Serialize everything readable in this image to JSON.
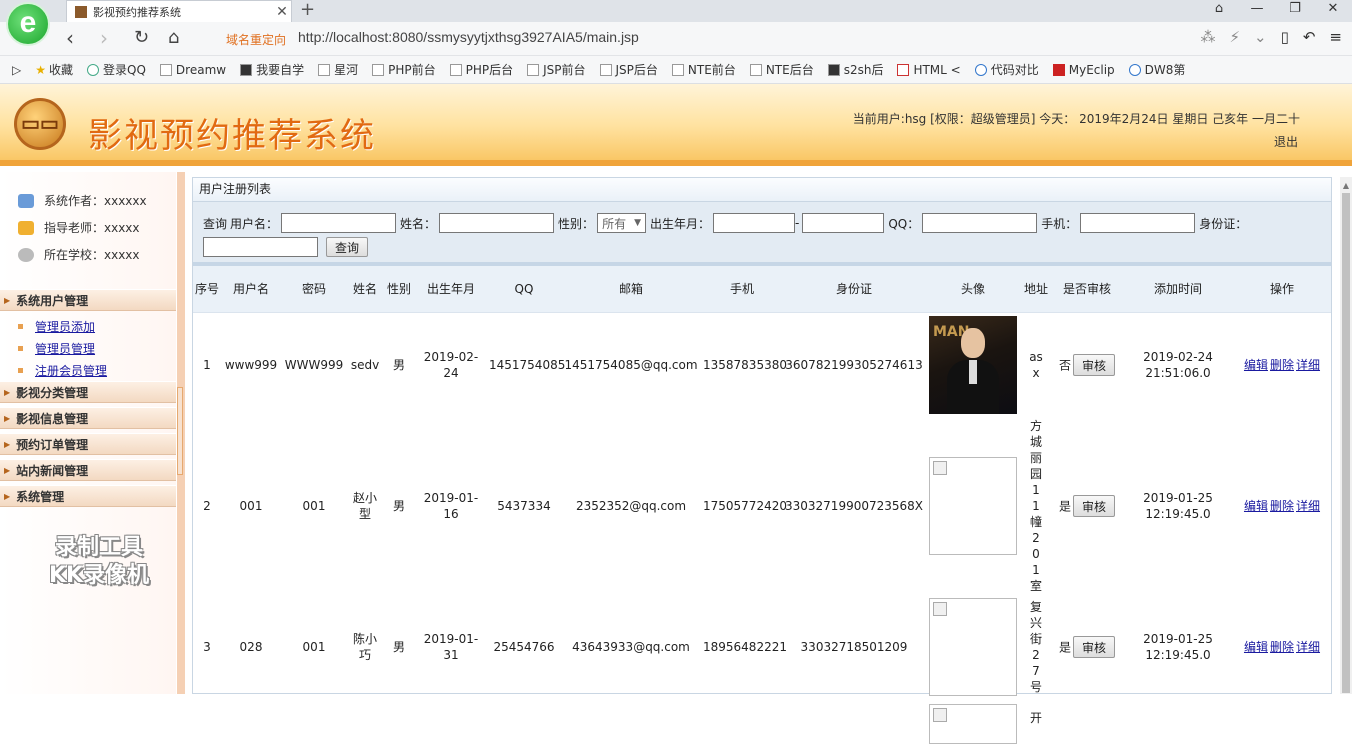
{
  "browser": {
    "tab_title": "影视预约推荐系统",
    "redirect_label": "域名重定向",
    "url": "http://localhost:8080/ssmysyytjxthsg3927AIA5/main.jsp",
    "bookmarks": [
      "收藏",
      "登录QQ",
      "Dreamw",
      "我要自学",
      "星河",
      "PHP前台",
      "PHP后台",
      "JSP前台",
      "JSP后台",
      "NTE前台",
      "NTE后台",
      "s2sh后",
      "HTML <",
      "代码对比",
      "MyEclip",
      "DW8第"
    ]
  },
  "header": {
    "title": "影视预约推荐系统",
    "user_info": "当前用户:hsg [权限：超级管理员] 今天： 2019年2月24日 星期日 己亥年 一月二十",
    "logout": "退出"
  },
  "sidebar": {
    "info": [
      {
        "label": "系统作者：xxxxxx"
      },
      {
        "label": "指导老师：xxxxx"
      },
      {
        "label": "所在学校：xxxxx"
      }
    ],
    "groups": [
      "系统用户管理",
      "影视分类管理",
      "影视信息管理",
      "预约订单管理",
      "站内新闻管理",
      "系统管理"
    ],
    "sub_items": [
      "管理员添加",
      "管理员管理",
      "注册会员管理"
    ],
    "watermark_line1": "录制工具",
    "watermark_line2": "KK录像机"
  },
  "panel": {
    "title": "用户注册列表"
  },
  "search": {
    "prefix": "查询",
    "username_label": "用户名：",
    "name_label": "姓名：",
    "gender_label": "性别：",
    "gender_value": "所有",
    "birth_label": "出生年月：",
    "dash": "-",
    "qq_label": "QQ：",
    "phone_label": "手机：",
    "id_label": "身份证：",
    "button": "查询"
  },
  "table": {
    "columns": [
      "序号",
      "用户名",
      "密码",
      "姓名",
      "性别",
      "出生年月",
      "QQ",
      "邮箱",
      "手机",
      "身份证",
      "头像",
      "地址",
      "是否审核",
      "添加时间",
      "操作"
    ],
    "audit_button": "审核",
    "ops": [
      "编辑",
      "删除",
      "详细"
    ],
    "photo_brand": "MAN",
    "rows": [
      {
        "no": "1",
        "username": "www999",
        "password": "WWW999",
        "name": "sedv",
        "gender": "男",
        "birth": "2019-02-24",
        "qq": "1451754085",
        "email": "1451754085@qq.com",
        "phone": "13587835380",
        "idcard": "360782199305274613",
        "address": "asx",
        "audited": "否",
        "time": "2019-02-24 21:51:06.0"
      },
      {
        "no": "2",
        "username": "001",
        "password": "001",
        "name": "赵小型",
        "gender": "男",
        "birth": "2019-01-16",
        "qq": "5437334",
        "email": "2352352@qq.com",
        "phone": "17505772420",
        "idcard": "33032719900723568X",
        "address": "方城丽园11幢201室",
        "audited": "是",
        "time": "2019-01-25 12:19:45.0"
      },
      {
        "no": "3",
        "username": "028",
        "password": "001",
        "name": "陈小巧",
        "gender": "男",
        "birth": "2019-01-31",
        "qq": "25454766",
        "email": "43643933@qq.com",
        "phone": "18956482221",
        "idcard": "33032718501209",
        "address": "复兴街27号",
        "audited": "是",
        "time": "2019-01-25 12:19:45.0"
      },
      {
        "no": "",
        "username": "",
        "password": "",
        "name": "",
        "gender": "",
        "birth": "",
        "qq": "",
        "email": "",
        "phone": "",
        "idcard": "",
        "address": "开",
        "audited": "",
        "time": ""
      }
    ]
  },
  "colors": {
    "title_orange": "#e16a12",
    "link_blue": "#1a1aa0",
    "header_band": "#f0a43a"
  }
}
